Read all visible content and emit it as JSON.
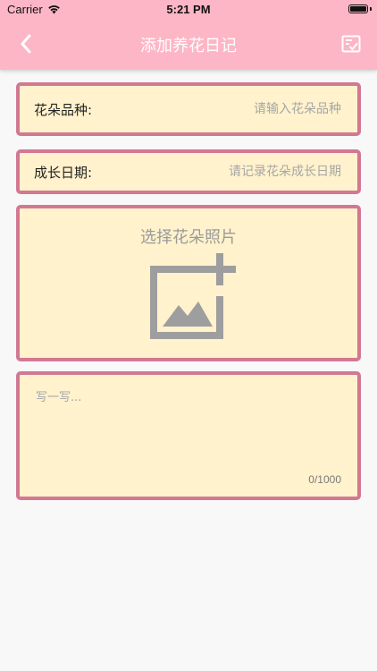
{
  "status_bar": {
    "carrier": "Carrier",
    "time": "5:21 PM"
  },
  "nav": {
    "title": "添加养花日记",
    "back_icon": "chevron-left-icon",
    "save_icon": "checklist-icon"
  },
  "form": {
    "variety_label": "花朵品种:",
    "variety_placeholder": "请输入花朵品种",
    "variety_value": "",
    "date_label": "成长日期:",
    "date_placeholder": "请记录花朵成长日期",
    "date_value": "",
    "photo_title": "选择花朵照片",
    "photo_icon": "add-photo-icon",
    "note_placeholder": "写一写...",
    "note_value": "",
    "note_counter": "0/1000"
  },
  "colors": {
    "header_bg": "#fdb6c5",
    "card_bg": "#fff2cc",
    "card_border": "#d27893",
    "icon_gray": "#9e9e9e",
    "page_bg": "#f8f8f8"
  }
}
